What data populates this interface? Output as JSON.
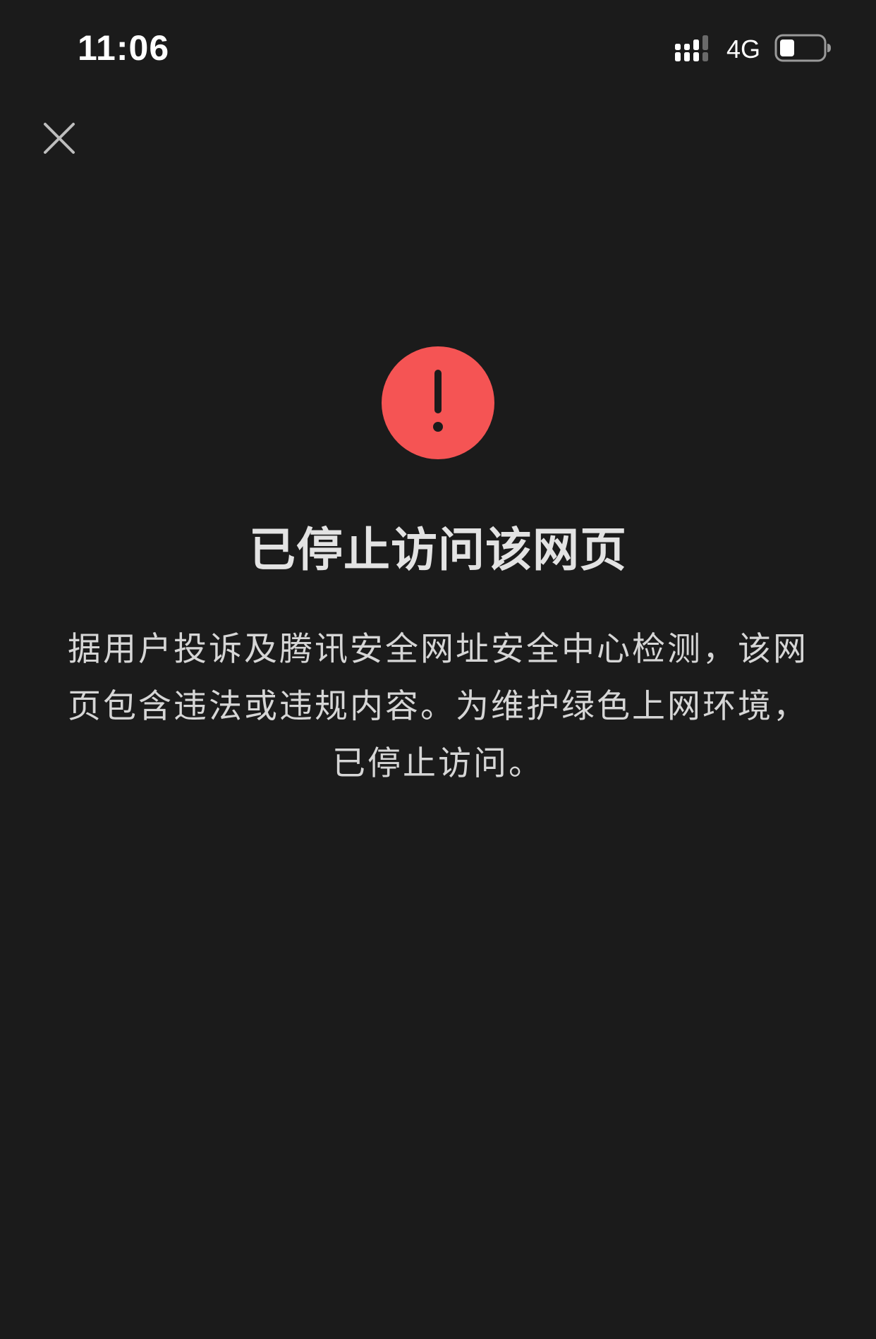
{
  "status_bar": {
    "time": "11:06",
    "network": "4G",
    "signal_icon": "cellular-signal-icon",
    "battery_icon": "battery-icon",
    "battery_level": 0.25
  },
  "header": {
    "close_icon": "close-icon"
  },
  "main": {
    "alert_icon": "exclamation-icon",
    "alert_color": "#f55454",
    "title": "已停止访问该网页",
    "message": "据用户投诉及腾讯安全网址安全中心检测，该网页包含违法或违规内容。为维护绿色上网环境，已停止访问。"
  },
  "colors": {
    "background": "#1b1b1b",
    "title_text": "#e3e3e3",
    "body_text": "#d6d6d6"
  }
}
